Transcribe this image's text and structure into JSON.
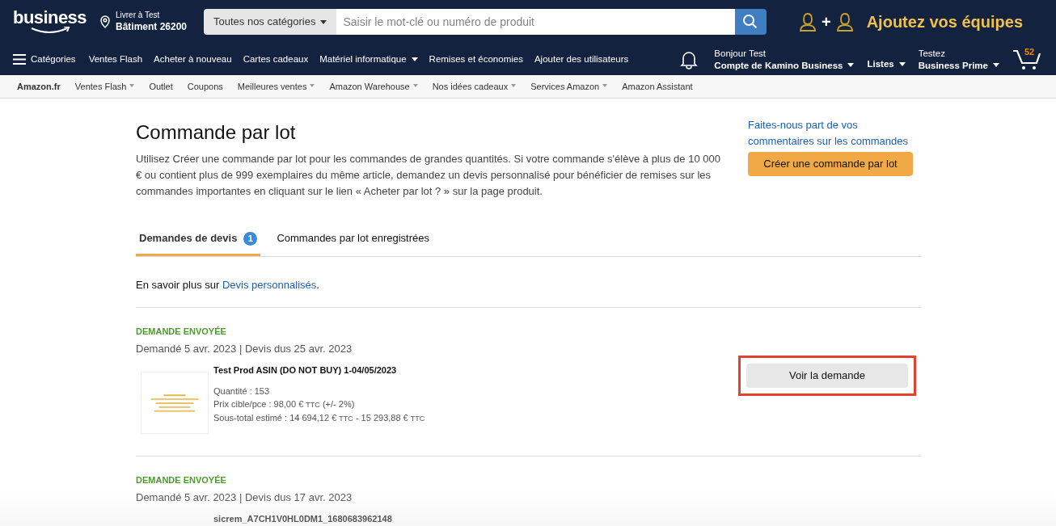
{
  "header": {
    "logo": "business",
    "deliver_label": "Livrer à Test",
    "deliver_place": "Bâtiment 26200",
    "search_category": "Toutes nos catégories",
    "search_placeholder": "Saisir le mot-clé ou numéro de produit",
    "promo": "Ajoutez vos équipes",
    "promo_plus": "+"
  },
  "nav": {
    "menu_label": "Catégories",
    "items": [
      {
        "label": "Ventes Flash",
        "dropdown": false
      },
      {
        "label": "Acheter à nouveau",
        "dropdown": false
      },
      {
        "label": "Cartes cadeaux",
        "dropdown": false
      },
      {
        "label": "Matériel informatique",
        "dropdown": true
      },
      {
        "label": "Remises et économies",
        "dropdown": false
      },
      {
        "label": "Ajouter des utilisateurs",
        "dropdown": false
      }
    ],
    "account_greeting": "Bonjour Test",
    "account_name": "Compte de Kamino Business",
    "lists": "Listes",
    "prime_top": "Testez",
    "prime_bottom": "Business Prime",
    "cart_count": "52"
  },
  "subnav": [
    {
      "label": "Amazon.fr",
      "dropdown": false,
      "bold": true
    },
    {
      "label": "Ventes Flash",
      "dropdown": true,
      "bold": false
    },
    {
      "label": "Outlet",
      "dropdown": false,
      "bold": false
    },
    {
      "label": "Coupons",
      "dropdown": false,
      "bold": false
    },
    {
      "label": "Meilleures ventes",
      "dropdown": true,
      "bold": false
    },
    {
      "label": "Amazon Warehouse",
      "dropdown": true,
      "bold": false
    },
    {
      "label": "Nos idées cadeaux",
      "dropdown": true,
      "bold": false
    },
    {
      "label": "Services Amazon",
      "dropdown": true,
      "bold": false
    },
    {
      "label": "Amazon Assistant",
      "dropdown": false,
      "bold": false
    }
  ],
  "page": {
    "title": "Commande par lot",
    "description": "Utilisez Créer une commande par lot pour les commandes de grandes quantités. Si votre commande s'élève à plus de 10 000 € ou contient plus de 999 exemplaires du même article, demandez un devis personnalisé pour bénéficier de remises sur les commandes importantes en cliquant sur le lien « Acheter par lot ? » sur la page produit.",
    "feedback_link": "Faites-nous part de vos commentaires sur les commandes",
    "create_button": "Créer une commande par lot"
  },
  "tabs": [
    {
      "label": "Demandes de devis",
      "badge": "1",
      "selected": true
    },
    {
      "label": "Commandes par lot enregistrées",
      "selected": false
    }
  ],
  "info": {
    "text": "En savoir plus sur ",
    "link": "Devis personnalisés",
    "after": "."
  },
  "requests": [
    {
      "status": "DEMANDE ENVOYÉE",
      "dates": "Demandé 5 avr. 2023 | Devis dus 25 avr. 2023",
      "product": "Test Prod ASIN (DO NOT BUY) 1-04/05/2023",
      "quantity": "Quantité : 153",
      "target_price": "Prix cible/pce : 98,00 €",
      "target_ttc": "TTC",
      "target_margin": "(+/- 2%)",
      "subtotal": "Sous-total estimé : 14 694,12 €",
      "subtotal_ttc": "TTC",
      "subtotal_sep": "-",
      "subtotal_high": "15 293,88 €",
      "subtotal_high_ttc": "TTC",
      "button": "Voir la demande",
      "highlighted": true
    },
    {
      "status": "DEMANDE ENVOYÉE",
      "dates": "Demandé 5 avr. 2023 | Devis dus 17 avr. 2023",
      "product": "sicrem_A7CH1V0HL0DM1_1680683962148"
    }
  ]
}
